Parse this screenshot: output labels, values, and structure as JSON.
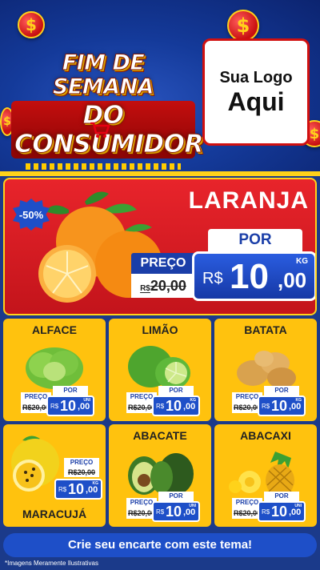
{
  "header": {
    "headline_line1": "FIM DE SEMANA",
    "headline_line2": "DO CONSUMIDOR",
    "coin_symbol": "$",
    "logo_line1": "Sua Logo",
    "logo_line2": "Aqui"
  },
  "hero": {
    "discount": "-50%",
    "title": "LARANJA",
    "por_label": "POR",
    "preco_label": "PREÇO",
    "old_price_currency": "R$",
    "old_price": "20,00",
    "currency": "R$",
    "price_int": "10",
    "price_dec": ",00",
    "unit": "KG"
  },
  "products": [
    {
      "name": "ALFACE",
      "preco_label": "PREÇO",
      "old_price": "R$20,00",
      "por_label": "POR",
      "currency": "R$",
      "price_int": "10",
      "price_dec": ",00",
      "unit": "UNI"
    },
    {
      "name": "LIMÃO",
      "preco_label": "PREÇO",
      "old_price": "R$20,00",
      "por_label": "POR",
      "currency": "R$",
      "price_int": "10",
      "price_dec": ",00",
      "unit": "KG"
    },
    {
      "name": "BATATA",
      "preco_label": "PREÇO",
      "old_price": "R$20,00",
      "por_label": "POR",
      "currency": "R$",
      "price_int": "10",
      "price_dec": ",00",
      "unit": "KG"
    },
    {
      "name": "MARACUJÁ",
      "preco_label": "PREÇO",
      "old_price": "R$20,00",
      "por_label": "POR",
      "currency": "R$",
      "price_int": "10",
      "price_dec": ",00",
      "unit": "KG"
    },
    {
      "name": "ABACATE",
      "preco_label": "PREÇO",
      "old_price": "R$20,00",
      "por_label": "POR",
      "currency": "R$",
      "price_int": "10",
      "price_dec": ",00",
      "unit": "UNI"
    },
    {
      "name": "ABACAXI",
      "preco_label": "PREÇO",
      "old_price": "R$20,00",
      "por_label": "POR",
      "currency": "R$",
      "price_int": "10",
      "price_dec": ",00",
      "unit": "UNI"
    }
  ],
  "footer": {
    "cta": "Crie seu encarte com este tema!",
    "disclaimer": "*Imagens Meramente Ilustrativas"
  },
  "colors": {
    "brand_blue": "#1e4fc8",
    "brand_red": "#e8242b",
    "brand_yellow": "#ffc20e"
  }
}
